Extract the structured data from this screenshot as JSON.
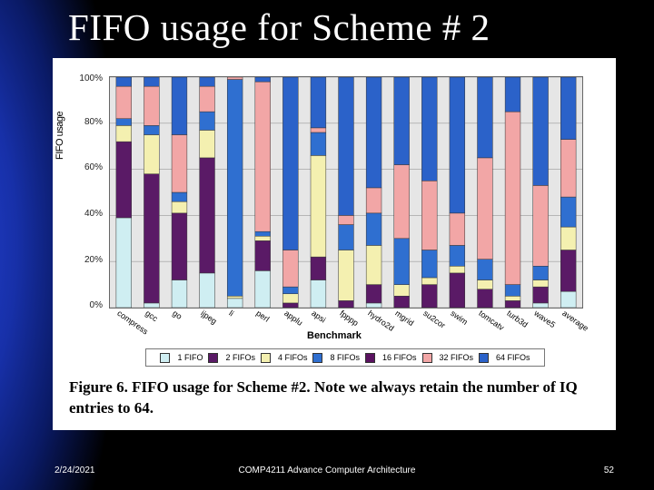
{
  "title": "FIFO usage for Scheme # 2",
  "footer": {
    "date": "2/24/2021",
    "course": "COMP4211 Advance Computer Architecture",
    "page": "52"
  },
  "caption": "Figure 6. FIFO usage for Scheme #2.  Note we always retain the number of IQ entries to 64.",
  "chart_data": {
    "type": "bar",
    "stacked": true,
    "ylabel": "FIFO usage",
    "xlabel": "Benchmark",
    "ylim": [
      0,
      100
    ],
    "yticks": [
      "0%",
      "20%",
      "40%",
      "60%",
      "80%",
      "100%"
    ],
    "categories": [
      "compress",
      "gcc",
      "go",
      "ijpeg",
      "li",
      "perl",
      "applu",
      "apsi",
      "fpppp",
      "hydro2d",
      "mgrid",
      "su2cor",
      "swim",
      "tomcatv",
      "turb3d",
      "wave5",
      "average"
    ],
    "legend": [
      "1 FIFO",
      "2 FIFOs",
      "4 FIFOs",
      "8 FIFOs",
      "16 FIFOs",
      "32 FIFOs",
      "64 FIFOs"
    ],
    "colors": [
      "#cfeef2",
      "#5a1a66",
      "#f4f0b0",
      "#2f6fd0",
      "#5a1260",
      "#f2a6a6",
      "#2b62c9"
    ],
    "series": [
      {
        "name": "1 FIFO",
        "values": [
          39,
          2,
          12,
          15,
          4,
          16,
          0,
          12,
          0,
          2,
          0,
          0,
          0,
          0,
          0,
          2,
          7
        ]
      },
      {
        "name": "2 FIFOs",
        "values": [
          33,
          56,
          29,
          50,
          0,
          13,
          2,
          10,
          3,
          8,
          5,
          10,
          15,
          8,
          3,
          7,
          18
        ]
      },
      {
        "name": "4 FIFOs",
        "values": [
          7,
          17,
          5,
          12,
          1,
          2,
          4,
          44,
          22,
          17,
          5,
          3,
          3,
          4,
          2,
          3,
          10
        ]
      },
      {
        "name": "8 FIFOs",
        "values": [
          3,
          4,
          4,
          8,
          94,
          2,
          3,
          10,
          11,
          14,
          20,
          12,
          9,
          9,
          5,
          6,
          13
        ]
      },
      {
        "name": "16 FIFOs",
        "values": [
          0,
          0,
          0,
          0,
          0,
          0,
          0,
          0,
          0,
          0,
          0,
          0,
          0,
          0,
          0,
          0,
          0
        ]
      },
      {
        "name": "32 FIFOs",
        "values": [
          14,
          17,
          25,
          11,
          1,
          65,
          16,
          2,
          4,
          11,
          32,
          30,
          14,
          44,
          75,
          35,
          25
        ]
      },
      {
        "name": "64 FIFOs",
        "values": [
          4,
          4,
          25,
          4,
          0,
          2,
          75,
          22,
          60,
          48,
          38,
          45,
          59,
          35,
          15,
          47,
          27
        ]
      }
    ]
  }
}
